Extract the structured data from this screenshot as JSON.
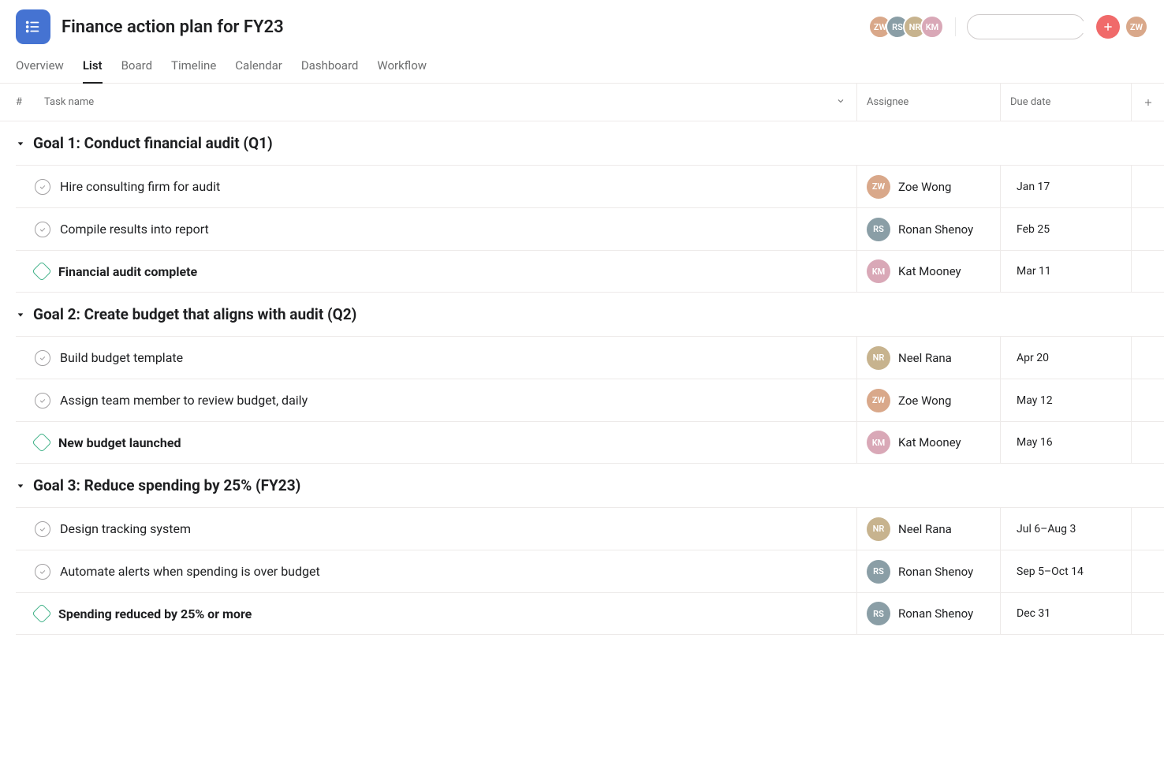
{
  "project": {
    "title": "Finance action plan for FY23"
  },
  "tabs": [
    {
      "label": "Overview",
      "active": false
    },
    {
      "label": "List",
      "active": true
    },
    {
      "label": "Board",
      "active": false
    },
    {
      "label": "Timeline",
      "active": false
    },
    {
      "label": "Calendar",
      "active": false
    },
    {
      "label": "Dashboard",
      "active": false
    },
    {
      "label": "Workflow",
      "active": false
    }
  ],
  "columns": {
    "num": "#",
    "task": "Task name",
    "assignee": "Assignee",
    "due": "Due date"
  },
  "header_avatars": [
    {
      "initials": "ZW",
      "color": "#d9a88a"
    },
    {
      "initials": "RS",
      "color": "#8a9ea6"
    },
    {
      "initials": "NR",
      "color": "#c7b38e"
    },
    {
      "initials": "KM",
      "color": "#d9a8b7"
    }
  ],
  "current_user": {
    "initials": "ZW",
    "color": "#d9a88a"
  },
  "search": {
    "placeholder": ""
  },
  "sections": [
    {
      "title": "Goal 1: Conduct financial audit (Q1)",
      "tasks": [
        {
          "name": "Hire consulting firm for audit",
          "type": "task",
          "bold": false,
          "assignee": {
            "name": "Zoe Wong",
            "color": "#d9a88a",
            "initials": "ZW"
          },
          "due": "Jan 17"
        },
        {
          "name": "Compile results into report",
          "type": "task",
          "bold": false,
          "assignee": {
            "name": "Ronan Shenoy",
            "color": "#8a9ea6",
            "initials": "RS"
          },
          "due": "Feb 25"
        },
        {
          "name": "Financial audit complete",
          "type": "milestone",
          "bold": true,
          "assignee": {
            "name": "Kat Mooney",
            "color": "#d9a8b7",
            "initials": "KM"
          },
          "due": "Mar 11"
        }
      ]
    },
    {
      "title": "Goal 2: Create budget that aligns with audit (Q2)",
      "tasks": [
        {
          "name": "Build budget template",
          "type": "task",
          "bold": false,
          "assignee": {
            "name": "Neel Rana",
            "color": "#c7b38e",
            "initials": "NR"
          },
          "due": "Apr 20"
        },
        {
          "name": "Assign team member to review budget, daily",
          "type": "task",
          "bold": false,
          "assignee": {
            "name": "Zoe Wong",
            "color": "#d9a88a",
            "initials": "ZW"
          },
          "due": "May 12"
        },
        {
          "name": "New budget launched",
          "type": "milestone",
          "bold": true,
          "assignee": {
            "name": "Kat Mooney",
            "color": "#d9a8b7",
            "initials": "KM"
          },
          "due": "May 16"
        }
      ]
    },
    {
      "title": "Goal 3: Reduce spending by 25% (FY23)",
      "tasks": [
        {
          "name": "Design tracking system",
          "type": "task",
          "bold": false,
          "assignee": {
            "name": "Neel Rana",
            "color": "#c7b38e",
            "initials": "NR"
          },
          "due": "Jul 6–Aug 3"
        },
        {
          "name": "Automate alerts when spending is over budget",
          "type": "task",
          "bold": false,
          "assignee": {
            "name": "Ronan Shenoy",
            "color": "#8a9ea6",
            "initials": "RS"
          },
          "due": "Sep 5–Oct 14"
        },
        {
          "name": "Spending reduced by 25% or more",
          "type": "milestone",
          "bold": true,
          "assignee": {
            "name": "Ronan Shenoy",
            "color": "#8a9ea6",
            "initials": "RS"
          },
          "due": "Dec 31"
        }
      ]
    }
  ]
}
